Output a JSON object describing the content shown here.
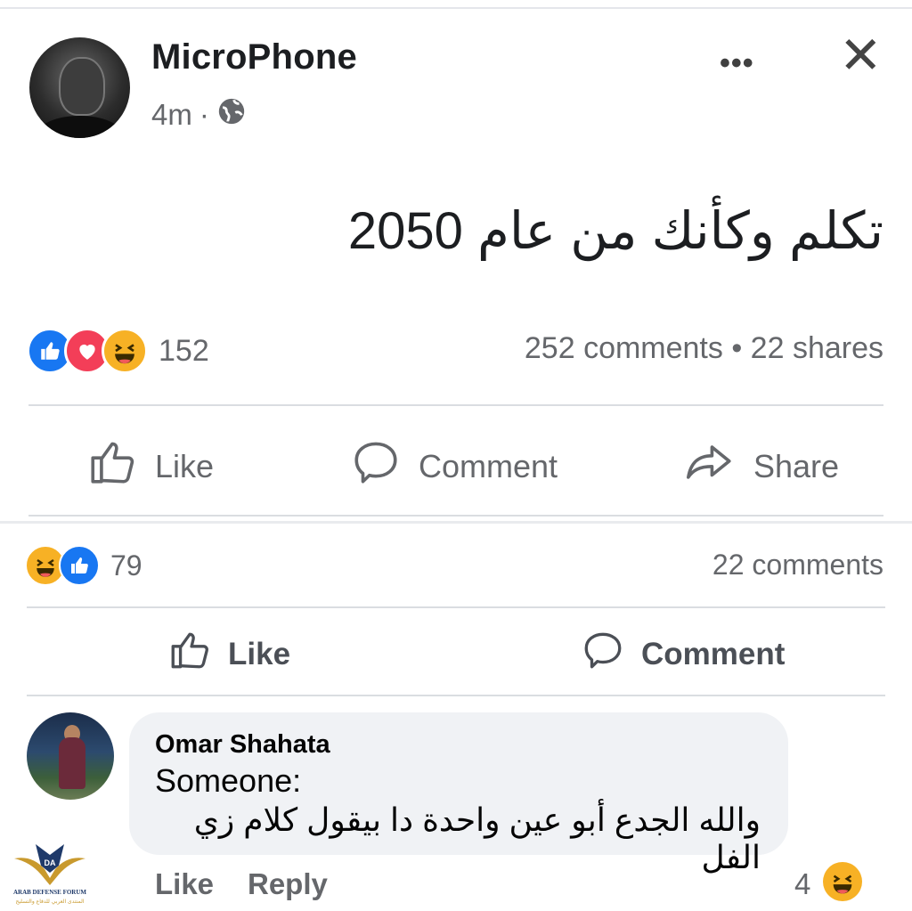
{
  "post": {
    "author": "MicroPhone",
    "time": "4m",
    "separator": "·",
    "text": "تكلم وكأنك من عام 2050",
    "reaction_count": "152",
    "stats": "252 comments • 22 shares",
    "actions": {
      "like": "Like",
      "comment": "Comment",
      "share": "Share"
    },
    "icons": {
      "more": "more-options-icon",
      "close": "close-icon",
      "privacy": "globe-icon"
    }
  },
  "post_glyphs": {
    "more": "•••",
    "close": "✕"
  },
  "embedded_comment_section": {
    "reaction_count": "79",
    "stats": "22 comments",
    "actions": {
      "like": "Like",
      "comment": "Comment"
    }
  },
  "comment": {
    "author": "Omar Shahata",
    "line1": "Someone:",
    "line2": "والله الجدع أبو عين واحدة دا بيقول كلام زي الفل",
    "actions": {
      "like": "Like",
      "reply": "Reply"
    },
    "reaction_count": "4"
  },
  "watermark": {
    "title": "ARAB DEFENSE FORUM",
    "subtitle": "المنتدى العربي للدفاع والتسليح",
    "monogram": "DA"
  },
  "colors": {
    "like_blue": "#1877f2",
    "love_red": "#f33e58",
    "haha_yellow": "#f7b125",
    "secondary_text": "#65676b",
    "bubble_bg": "#f0f2f5"
  }
}
